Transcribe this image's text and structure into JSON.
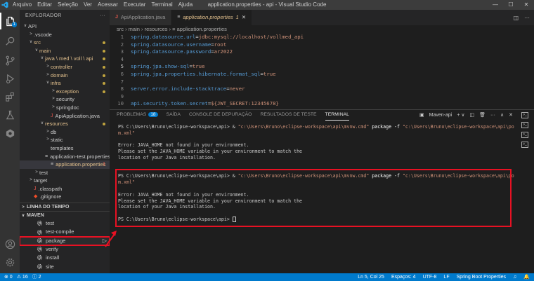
{
  "window": {
    "title": "application.properties - api - Visual Studio Code",
    "menu": [
      "Arquivo",
      "Editar",
      "Seleção",
      "Ver",
      "Acessar",
      "Executar",
      "Terminal",
      "Ajuda"
    ]
  },
  "activity": {
    "items": [
      "files-icon",
      "search-icon",
      "source-control-icon",
      "run-debug-icon",
      "extensions-icon",
      "testing-icon",
      "spring-boot-icon"
    ],
    "scm_badge": "1"
  },
  "sidebar": {
    "title": "EXPLORADOR",
    "tree": [
      {
        "label": "API",
        "depth": 0,
        "chev": "∨",
        "color": "white"
      },
      {
        "label": ".vscode",
        "depth": 1,
        "chev": ">",
        "color": "white"
      },
      {
        "label": "src",
        "depth": 1,
        "chev": "∨",
        "color": "yellow",
        "dot": true
      },
      {
        "label": "main",
        "depth": 2,
        "chev": "∨",
        "color": "yellow",
        "dot": true
      },
      {
        "label": "java \\ med \\ voll \\ api",
        "depth": 3,
        "chev": "∨",
        "color": "yellow",
        "dot": true
      },
      {
        "label": "controller",
        "depth": 4,
        "chev": ">",
        "color": "yellow",
        "dot": true
      },
      {
        "label": "domain",
        "depth": 4,
        "chev": ">",
        "color": "yellow",
        "dot": true
      },
      {
        "label": "infra",
        "depth": 4,
        "chev": "∨",
        "color": "yellow",
        "dot": true
      },
      {
        "label": "exception",
        "depth": 5,
        "chev": ">",
        "color": "yellow",
        "dot": true
      },
      {
        "label": "security",
        "depth": 5,
        "chev": ">",
        "color": "white"
      },
      {
        "label": "springdoc",
        "depth": 5,
        "chev": ">",
        "color": "white"
      },
      {
        "label": "ApiApplication.java",
        "depth": 4,
        "chev": "",
        "color": "white",
        "icon": "J"
      },
      {
        "label": "resources",
        "depth": 3,
        "chev": "∨",
        "color": "yellow",
        "dot": true
      },
      {
        "label": "db",
        "depth": 4,
        "chev": ">",
        "color": "white"
      },
      {
        "label": "static",
        "depth": 4,
        "chev": ">",
        "color": "white"
      },
      {
        "label": "templates",
        "depth": 4,
        "chev": "",
        "color": "white"
      },
      {
        "label": "application-test.properties",
        "depth": 4,
        "chev": "",
        "color": "white",
        "icon": "≡"
      },
      {
        "label": "application.properties",
        "depth": 4,
        "chev": "",
        "color": "yellow",
        "icon": "≡",
        "num": "1",
        "selected": true
      },
      {
        "label": "test",
        "depth": 2,
        "chev": ">",
        "color": "white"
      },
      {
        "label": "target",
        "depth": 1,
        "chev": ">",
        "color": "white"
      },
      {
        "label": ".classpath",
        "depth": 1,
        "chev": "",
        "color": "white",
        "icon": "J"
      },
      {
        "label": ".gitignore",
        "depth": 1,
        "chev": "",
        "color": "white",
        "icon": "◆"
      }
    ],
    "timeline_title": "LINHA DO TEMPO",
    "maven_title": "MAVEN",
    "maven_items": [
      "test",
      "test-compile",
      "package",
      "verify",
      "install",
      "site"
    ]
  },
  "tabs": [
    {
      "label": "ApiApplication.java",
      "icon": "J",
      "active": false
    },
    {
      "label": "application.properties",
      "icon": "≡",
      "active": true,
      "badge": "1"
    }
  ],
  "breadcrumb": "src › main › resources › ≡ application.properties",
  "code_lines": [
    {
      "n": "1",
      "key": "spring.datasource.url",
      "val": "jdbc:mysql://localhost/vollmed_api"
    },
    {
      "n": "2",
      "key": "spring.datasource.username",
      "val": "root"
    },
    {
      "n": "3",
      "key": "spring.datasource.password",
      "val": "ar2022"
    },
    {
      "n": "4",
      "key": "",
      "val": ""
    },
    {
      "n": "5",
      "key": "spring.jpa.show-sql",
      "val": "true",
      "current": true
    },
    {
      "n": "6",
      "key": "spring.jpa.properties.hibernate.format_sql",
      "val": "true"
    },
    {
      "n": "7",
      "key": "",
      "val": ""
    },
    {
      "n": "8",
      "key": "server.error.include-stacktrace",
      "val": "never"
    },
    {
      "n": "9",
      "key": "",
      "val": ""
    },
    {
      "n": "10",
      "key": "api.security.token.secret",
      "val": "${JWT_SECRET:12345678}"
    }
  ],
  "panel": {
    "tabs": [
      "PROBLEMAS",
      "SAÍDA",
      "CONSOLE DE DEPURAÇÃO",
      "RESULTADOS DE TESTE",
      "TERMINAL"
    ],
    "problems_badge": "18",
    "terminal_name": "Maven-api",
    "lines": [
      {
        "prompt": "PS C:\\Users\\Bruno\\eclipse-workspace\\api> & ",
        "cmd": "\"c:\\Users\\Bruno\\eclipse-workspace\\api\\mvnw.cmd\"",
        "rest": " package -f ",
        "arg": "\"c:\\Users\\Bruno\\eclipse-workspace\\api\\po"
      },
      {
        "text": "m.xml\"",
        "kind": "q"
      },
      {
        "text": ""
      },
      {
        "text": "Error: JAVA_HOME not found in your environment."
      },
      {
        "text": "Please set the JAVA_HOME variable in your environment to match the"
      },
      {
        "text": "location of your Java installation."
      },
      {
        "text": ""
      },
      {
        "text": ""
      },
      {
        "prompt": "PS C:\\Users\\Bruno\\eclipse-workspace\\api> & ",
        "cmd": "\"c:\\Users\\Bruno\\eclipse-workspace\\api\\mvnw.cmd\"",
        "rest": " package -f ",
        "arg": "\"c:\\Users\\Bruno\\eclipse-workspace\\api\\po"
      },
      {
        "text": "m.xml\"",
        "kind": "q"
      },
      {
        "text": ""
      },
      {
        "text": "Error: JAVA_HOME not found in your environment."
      },
      {
        "text": "Please set the JAVA_HOME variable in your environment to match the"
      },
      {
        "text": "location of your Java installation."
      },
      {
        "text": ""
      },
      {
        "text": "PS C:\\Users\\Bruno\\eclipse-workspace\\api> ",
        "cursor": true
      }
    ]
  },
  "status": {
    "left": [
      "⊗ 0",
      "⚠ 16",
      "ⓘ 2"
    ],
    "right": [
      "Ln 5, Col 25",
      "Espaços: 4",
      "UTF-8",
      "LF",
      "Spring Boot Properties",
      "♫",
      "🔔"
    ]
  },
  "colors": {
    "accent": "#007acc",
    "highlight": "#e81123",
    "modified": "#e2c08d"
  }
}
